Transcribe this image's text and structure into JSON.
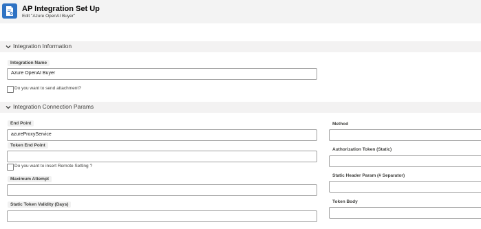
{
  "header": {
    "title": "AP Integration Set Up",
    "subtitle": "Edit \"Azure OpenAI Buyer\""
  },
  "sections": {
    "integration_information": "Integration Information",
    "connection_params": "Integration Connection Params"
  },
  "integration_info": {
    "name_label": "Integration Name",
    "name_value": "Azure OpenAI Buyer",
    "send_attachment_label": "Do you want to send attachment?"
  },
  "connection": {
    "end_point_label": "End Point",
    "end_point_value": "azureProxyService",
    "token_end_point_label": "Token End Point",
    "token_end_point_value": "",
    "remote_setting_label": "Do you want to insert Remote Setting ?",
    "maximum_attempt_label": "Maximum Attempt",
    "maximum_attempt_value": "",
    "static_token_validity_label": "Static Token Validity (Days)",
    "static_token_validity_value": "",
    "method_label": "Method",
    "method_value": "",
    "authorization_token_label": "Authorization Token (Static)",
    "authorization_token_value": "",
    "static_header_label": "Static Header Param (# Separator)",
    "static_header_value": "",
    "token_body_label": "Token Body",
    "token_body_value": ""
  }
}
